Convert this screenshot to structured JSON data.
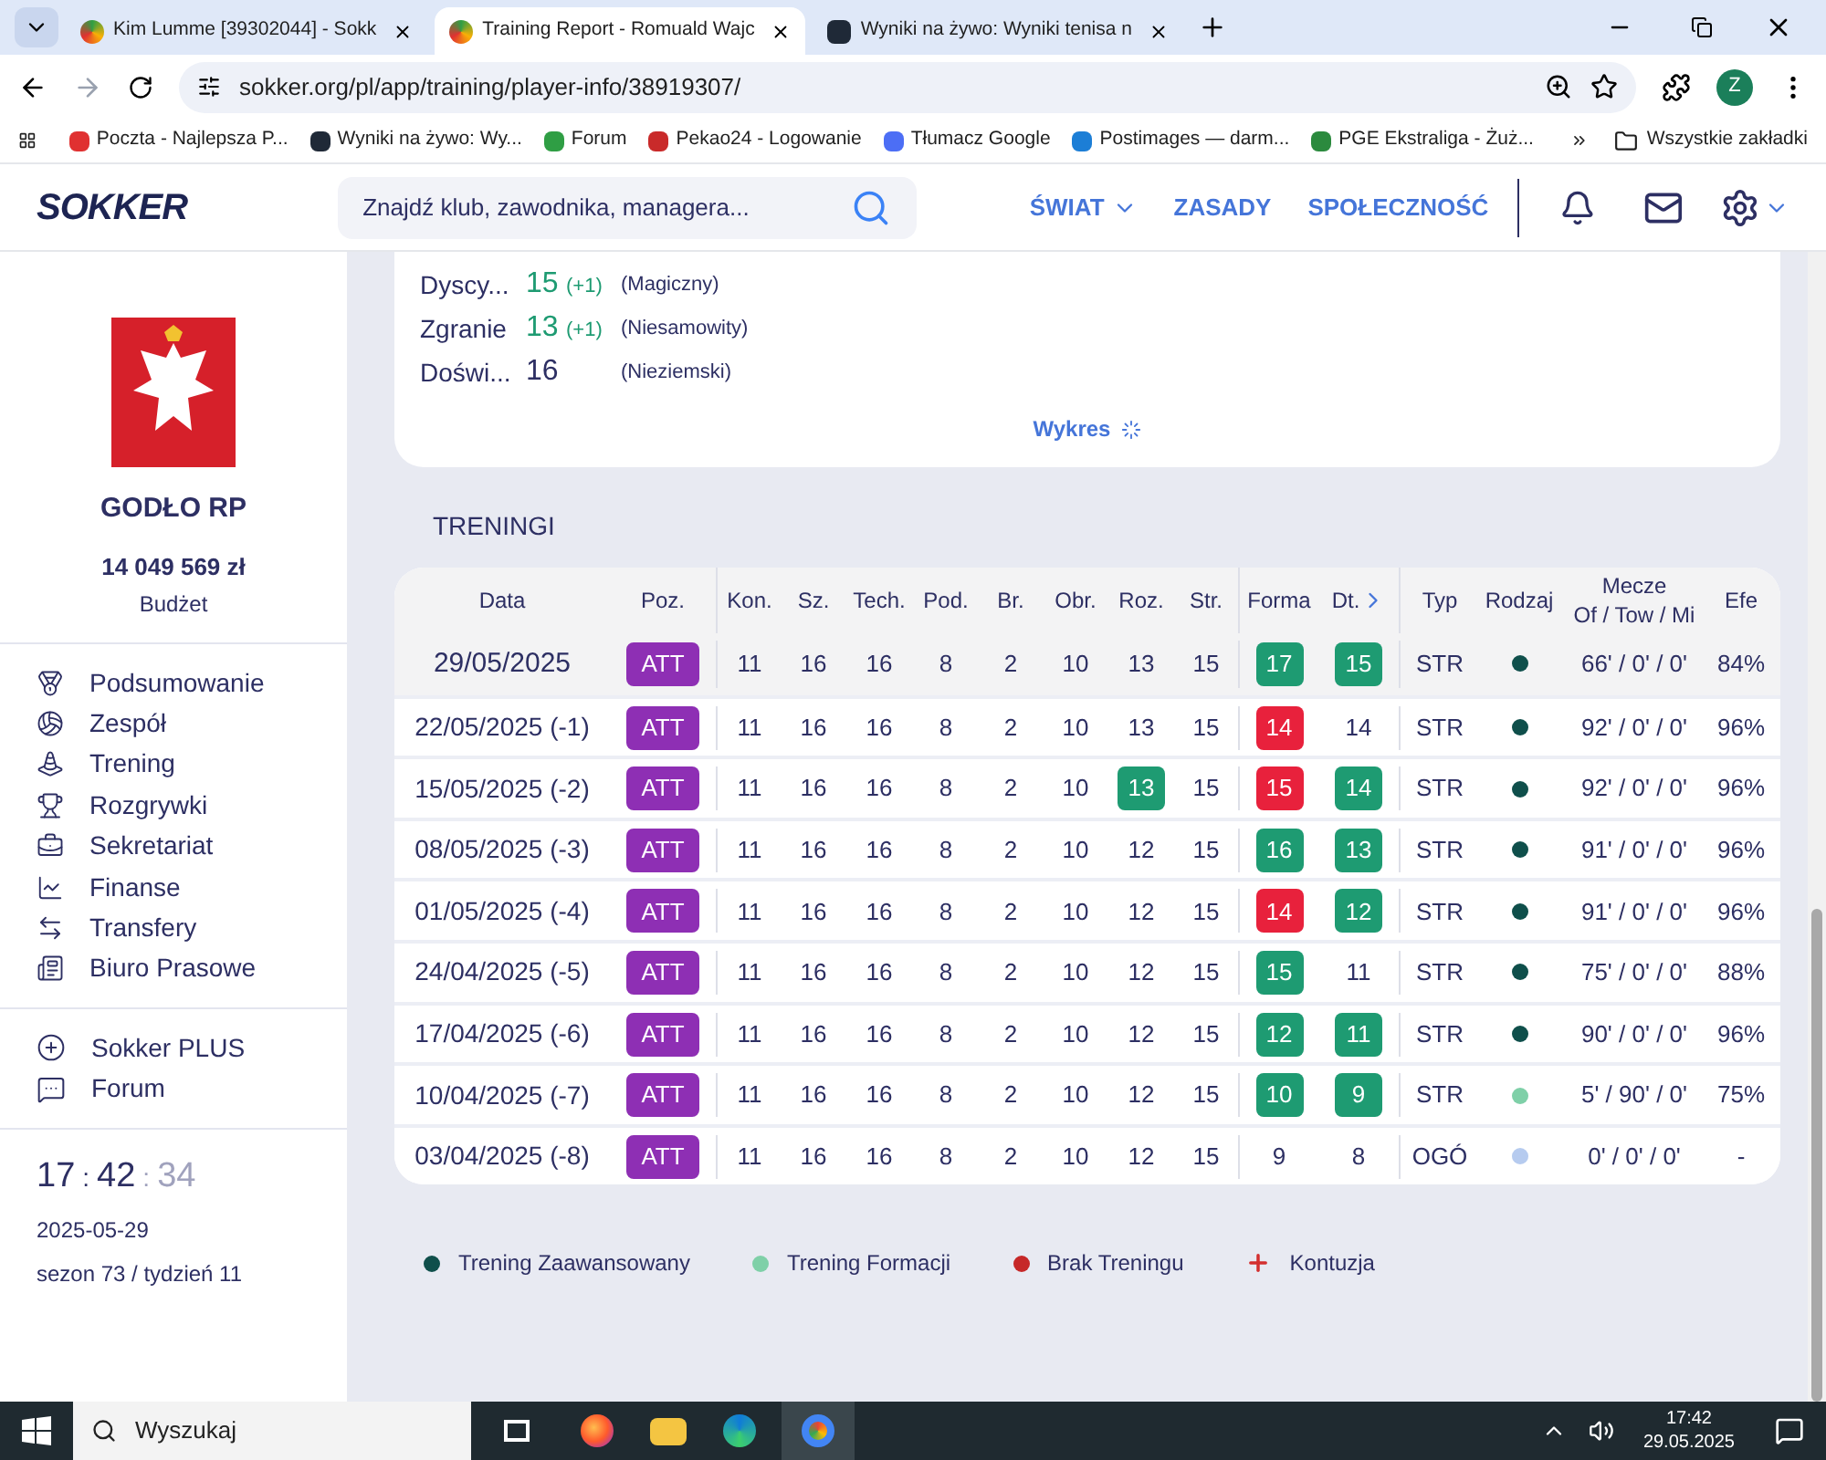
{
  "browser": {
    "tabs": [
      {
        "title": "Kim Lumme [39302044] - Sokk",
        "selected": false
      },
      {
        "title": "Training Report - Romuald Wajc",
        "selected": true
      },
      {
        "title": "Wyniki na żywo: Wyniki tenisa n",
        "selected": false
      }
    ],
    "url": "sokker.org/pl/app/training/player-info/38919307/",
    "profile": "Z",
    "bookmarks": [
      "Poczta - Najlepsza P...",
      "Wyniki na żywo: Wy...",
      "Forum",
      "Pekao24 - Logowanie",
      "Tłumacz Google",
      "Postimages — darm...",
      "PGE Ekstraliga - Żuż..."
    ],
    "all_bookmarks": "Wszystkie zakładki"
  },
  "header": {
    "logo": "SOKKER",
    "search": {
      "placeholder": "Znajdź klub, zawodnika, managera..."
    },
    "nav": [
      {
        "label": "ŚWIAT",
        "has_menu": true
      },
      {
        "label": "ZASADY",
        "has_menu": false
      },
      {
        "label": "SPOŁECZNOŚĆ",
        "has_menu": false
      }
    ]
  },
  "sidebar": {
    "club": "GODŁO RP",
    "budget": "14 049 569 zł",
    "budget_label": "Budżet",
    "menu": [
      "Podsumowanie",
      "Zespół",
      "Trening",
      "Rozgrywki",
      "Sekretariat",
      "Finanse",
      "Transfery",
      "Biuro Prasowe"
    ],
    "extra": [
      "Sokker PLUS",
      "Forum"
    ],
    "clock": {
      "h": "17",
      "m": "42",
      "s": "34",
      "sep": ":"
    },
    "date": "2025-05-29",
    "season": "sezon 73 / tydzień 11"
  },
  "stats": {
    "rows": [
      {
        "label": "Dyscy...",
        "value": "15",
        "change": "(+1)",
        "desc": "(Magiczny)",
        "kind": "up"
      },
      {
        "label": "Zgranie",
        "value": "13",
        "change": "(+1)",
        "desc": "(Niesamowity)",
        "kind": "up"
      },
      {
        "label": "Doświ...",
        "value": "16",
        "desc": "(Nieziemski)",
        "kind": "plain"
      }
    ],
    "link": "Wykres"
  },
  "trainings": {
    "title": "TRENINGI",
    "columns": [
      "Data",
      "Poz.",
      "Kon.",
      "Sz.",
      "Tech.",
      "Pod.",
      "Br.",
      "Obr.",
      "Roz.",
      "Str.",
      "Forma",
      "Dt.",
      "Typ",
      "Rodzaj",
      "Mecze",
      "Efe"
    ],
    "mecze_sub": "Of / Tow / Mi",
    "rows": [
      {
        "selected": true,
        "cells": [
          {
            "v": "29/05/2025",
            "kind": "date"
          },
          {
            "v": "ATT",
            "kind": "pos"
          },
          {
            "v": "11",
            "kind": "plain"
          },
          {
            "v": "16",
            "kind": "plain"
          },
          {
            "v": "16",
            "kind": "plain"
          },
          {
            "v": "8",
            "kind": "plain"
          },
          {
            "v": "2",
            "kind": "plain"
          },
          {
            "v": "10",
            "kind": "plain"
          },
          {
            "v": "13",
            "kind": "plain"
          },
          {
            "v": "15",
            "kind": "plain"
          },
          {
            "v": "17",
            "kind": "up"
          },
          {
            "v": "15",
            "kind": "up"
          },
          {
            "v": "STR",
            "kind": "plain"
          },
          {
            "kind": "dot",
            "color": "#0f4f4b"
          },
          {
            "v": "66' / 0' / 0'",
            "kind": "plain"
          },
          {
            "v": "84%",
            "kind": "plain"
          }
        ]
      },
      {
        "selected": false,
        "cells": [
          {
            "v": "22/05/2025 (-1)",
            "kind": "date"
          },
          {
            "v": "ATT",
            "kind": "pos"
          },
          {
            "v": "11",
            "kind": "plain"
          },
          {
            "v": "16",
            "kind": "plain"
          },
          {
            "v": "16",
            "kind": "plain"
          },
          {
            "v": "8",
            "kind": "plain"
          },
          {
            "v": "2",
            "kind": "plain"
          },
          {
            "v": "10",
            "kind": "plain"
          },
          {
            "v": "13",
            "kind": "plain"
          },
          {
            "v": "15",
            "kind": "plain"
          },
          {
            "v": "14",
            "kind": "down"
          },
          {
            "v": "14",
            "kind": "plain"
          },
          {
            "v": "STR",
            "kind": "plain"
          },
          {
            "kind": "dot",
            "color": "#0f4f4b"
          },
          {
            "v": "92' / 0' / 0'",
            "kind": "plain"
          },
          {
            "v": "96%",
            "kind": "plain"
          }
        ]
      },
      {
        "selected": false,
        "cells": [
          {
            "v": "15/05/2025 (-2)",
            "kind": "date"
          },
          {
            "v": "ATT",
            "kind": "pos"
          },
          {
            "v": "11",
            "kind": "plain"
          },
          {
            "v": "16",
            "kind": "plain"
          },
          {
            "v": "16",
            "kind": "plain"
          },
          {
            "v": "8",
            "kind": "plain"
          },
          {
            "v": "2",
            "kind": "plain"
          },
          {
            "v": "10",
            "kind": "plain"
          },
          {
            "v": "13",
            "kind": "up"
          },
          {
            "v": "15",
            "kind": "plain"
          },
          {
            "v": "15",
            "kind": "down"
          },
          {
            "v": "14",
            "kind": "up"
          },
          {
            "v": "STR",
            "kind": "plain"
          },
          {
            "kind": "dot",
            "color": "#0f4f4b"
          },
          {
            "v": "92' / 0' / 0'",
            "kind": "plain"
          },
          {
            "v": "96%",
            "kind": "plain"
          }
        ]
      },
      {
        "selected": false,
        "cells": [
          {
            "v": "08/05/2025 (-3)",
            "kind": "date"
          },
          {
            "v": "ATT",
            "kind": "pos"
          },
          {
            "v": "11",
            "kind": "plain"
          },
          {
            "v": "16",
            "kind": "plain"
          },
          {
            "v": "16",
            "kind": "plain"
          },
          {
            "v": "8",
            "kind": "plain"
          },
          {
            "v": "2",
            "kind": "plain"
          },
          {
            "v": "10",
            "kind": "plain"
          },
          {
            "v": "12",
            "kind": "plain"
          },
          {
            "v": "15",
            "kind": "plain"
          },
          {
            "v": "16",
            "kind": "up"
          },
          {
            "v": "13",
            "kind": "up"
          },
          {
            "v": "STR",
            "kind": "plain"
          },
          {
            "kind": "dot",
            "color": "#0f4f4b"
          },
          {
            "v": "91' / 0' / 0'",
            "kind": "plain"
          },
          {
            "v": "96%",
            "kind": "plain"
          }
        ]
      },
      {
        "selected": false,
        "cells": [
          {
            "v": "01/05/2025 (-4)",
            "kind": "date"
          },
          {
            "v": "ATT",
            "kind": "pos"
          },
          {
            "v": "11",
            "kind": "plain"
          },
          {
            "v": "16",
            "kind": "plain"
          },
          {
            "v": "16",
            "kind": "plain"
          },
          {
            "v": "8",
            "kind": "plain"
          },
          {
            "v": "2",
            "kind": "plain"
          },
          {
            "v": "10",
            "kind": "plain"
          },
          {
            "v": "12",
            "kind": "plain"
          },
          {
            "v": "15",
            "kind": "plain"
          },
          {
            "v": "14",
            "kind": "down"
          },
          {
            "v": "12",
            "kind": "up"
          },
          {
            "v": "STR",
            "kind": "plain"
          },
          {
            "kind": "dot",
            "color": "#0f4f4b"
          },
          {
            "v": "91' / 0' / 0'",
            "kind": "plain"
          },
          {
            "v": "96%",
            "kind": "plain"
          }
        ]
      },
      {
        "selected": false,
        "cells": [
          {
            "v": "24/04/2025 (-5)",
            "kind": "date"
          },
          {
            "v": "ATT",
            "kind": "pos"
          },
          {
            "v": "11",
            "kind": "plain"
          },
          {
            "v": "16",
            "kind": "plain"
          },
          {
            "v": "16",
            "kind": "plain"
          },
          {
            "v": "8",
            "kind": "plain"
          },
          {
            "v": "2",
            "kind": "plain"
          },
          {
            "v": "10",
            "kind": "plain"
          },
          {
            "v": "12",
            "kind": "plain"
          },
          {
            "v": "15",
            "kind": "plain"
          },
          {
            "v": "15",
            "kind": "up"
          },
          {
            "v": "11",
            "kind": "plain"
          },
          {
            "v": "STR",
            "kind": "plain"
          },
          {
            "kind": "dot",
            "color": "#0f4f4b"
          },
          {
            "v": "75' / 0' / 0'",
            "kind": "plain"
          },
          {
            "v": "88%",
            "kind": "plain"
          }
        ]
      },
      {
        "selected": false,
        "cells": [
          {
            "v": "17/04/2025 (-6)",
            "kind": "date"
          },
          {
            "v": "ATT",
            "kind": "pos"
          },
          {
            "v": "11",
            "kind": "plain"
          },
          {
            "v": "16",
            "kind": "plain"
          },
          {
            "v": "16",
            "kind": "plain"
          },
          {
            "v": "8",
            "kind": "plain"
          },
          {
            "v": "2",
            "kind": "plain"
          },
          {
            "v": "10",
            "kind": "plain"
          },
          {
            "v": "12",
            "kind": "plain"
          },
          {
            "v": "15",
            "kind": "plain"
          },
          {
            "v": "12",
            "kind": "up"
          },
          {
            "v": "11",
            "kind": "up"
          },
          {
            "v": "STR",
            "kind": "plain"
          },
          {
            "kind": "dot",
            "color": "#0f4f4b"
          },
          {
            "v": "90' / 0' / 0'",
            "kind": "plain"
          },
          {
            "v": "96%",
            "kind": "plain"
          }
        ]
      },
      {
        "selected": false,
        "cells": [
          {
            "v": "10/04/2025 (-7)",
            "kind": "date"
          },
          {
            "v": "ATT",
            "kind": "pos"
          },
          {
            "v": "11",
            "kind": "plain"
          },
          {
            "v": "16",
            "kind": "plain"
          },
          {
            "v": "16",
            "kind": "plain"
          },
          {
            "v": "8",
            "kind": "plain"
          },
          {
            "v": "2",
            "kind": "plain"
          },
          {
            "v": "10",
            "kind": "plain"
          },
          {
            "v": "12",
            "kind": "plain"
          },
          {
            "v": "15",
            "kind": "plain"
          },
          {
            "v": "10",
            "kind": "up"
          },
          {
            "v": "9",
            "kind": "up"
          },
          {
            "v": "STR",
            "kind": "plain"
          },
          {
            "kind": "dot",
            "color": "#7fd0a8"
          },
          {
            "v": "5' / 90' / 0'",
            "kind": "plain"
          },
          {
            "v": "75%",
            "kind": "plain"
          }
        ]
      },
      {
        "selected": false,
        "cells": [
          {
            "v": "03/04/2025 (-8)",
            "kind": "date"
          },
          {
            "v": "ATT",
            "kind": "pos"
          },
          {
            "v": "11",
            "kind": "plain"
          },
          {
            "v": "16",
            "kind": "plain"
          },
          {
            "v": "16",
            "kind": "plain"
          },
          {
            "v": "8",
            "kind": "plain"
          },
          {
            "v": "2",
            "kind": "plain"
          },
          {
            "v": "10",
            "kind": "plain"
          },
          {
            "v": "12",
            "kind": "plain"
          },
          {
            "v": "15",
            "kind": "plain"
          },
          {
            "v": "9",
            "kind": "plain"
          },
          {
            "v": "8",
            "kind": "plain"
          },
          {
            "v": "OGÓ",
            "kind": "plain"
          },
          {
            "kind": "dot",
            "color": "#b6cbef"
          },
          {
            "v": "0' / 0' / 0'",
            "kind": "plain"
          },
          {
            "v": "-",
            "kind": "plain"
          }
        ]
      }
    ]
  },
  "legend": [
    {
      "label": "Trening Zaawansowany",
      "kind": "dot",
      "color": "#0f4f4b"
    },
    {
      "label": "Trening Formacji",
      "kind": "dot",
      "color": "#7fd0a8"
    },
    {
      "label": "Brak Treningu",
      "kind": "dot",
      "color": "#c62828"
    },
    {
      "label": "Kontuzja",
      "kind": "plus",
      "color": "#d32f2f"
    }
  ],
  "taskbar": {
    "search": {
      "placeholder": "Wyszukaj"
    },
    "time": "17:42",
    "date": "29.05.2025"
  }
}
